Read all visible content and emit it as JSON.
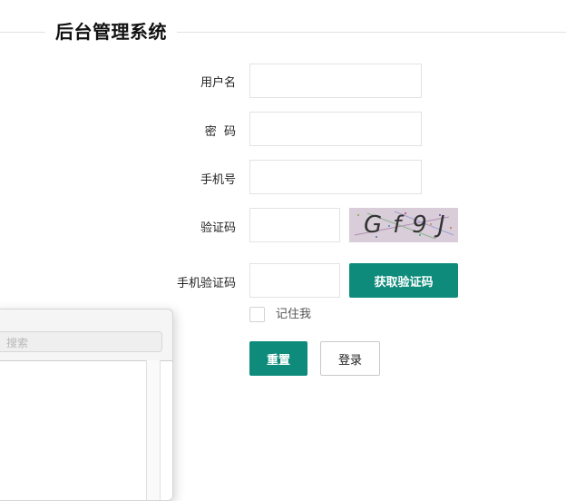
{
  "header": {
    "title": "后台管理系统"
  },
  "form": {
    "username_label": "用户名",
    "password_label": "密  码",
    "phone_label": "手机号",
    "captcha_label": "验证码",
    "captcha_image_text": "Gf9J",
    "sms_label": "手机验证码",
    "username_value": "",
    "password_value": "",
    "phone_value": "",
    "captcha_value": "",
    "sms_value": "",
    "get_code_button": "获取验证码",
    "remember_label": "记住我",
    "remember_checked": false,
    "reset_button": "重置",
    "login_button": "登录"
  },
  "overlay_panel": {
    "search_placeholder": "搜索"
  },
  "colors": {
    "accent": "#0f8b7c",
    "captcha_bg": "#d8cdd9"
  }
}
